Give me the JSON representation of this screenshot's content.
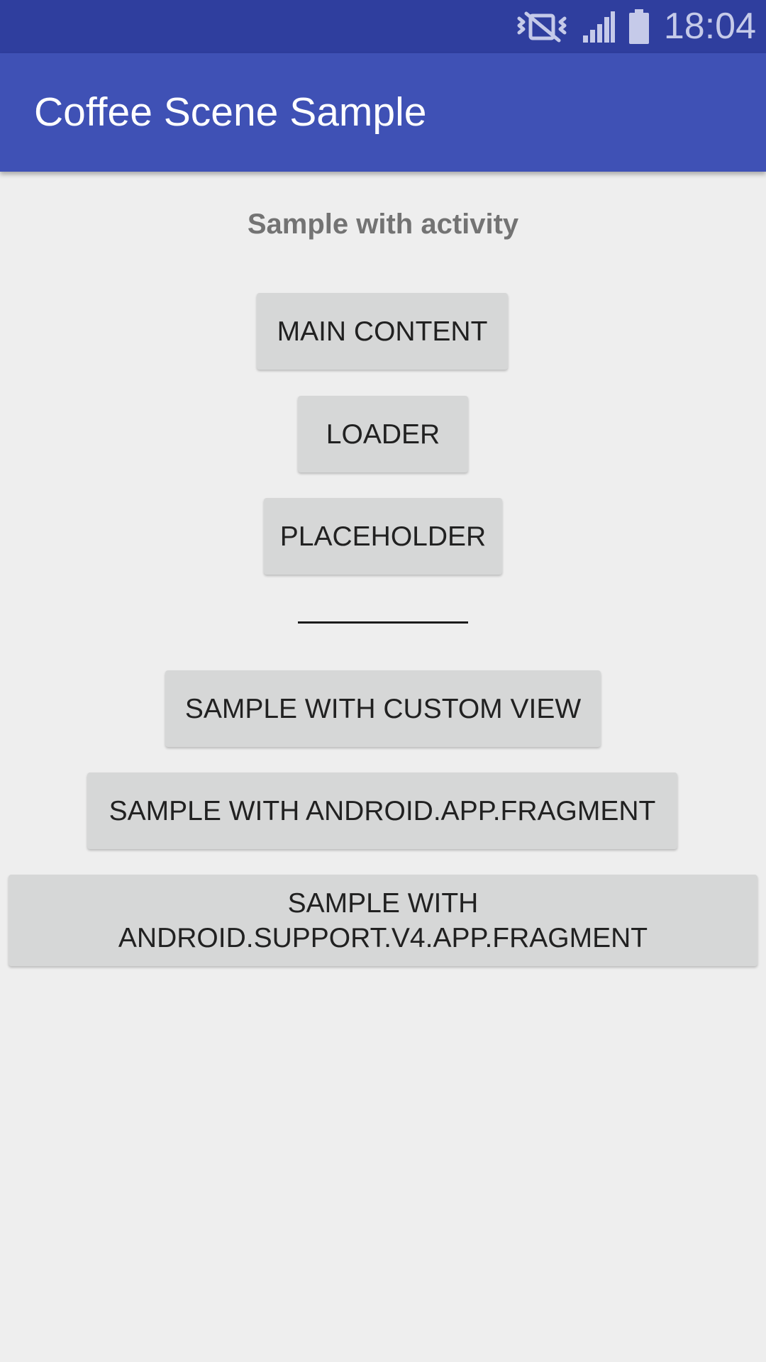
{
  "status_bar": {
    "time": "18:04",
    "icons": [
      "vibrate-mute-icon",
      "cell-signal-icon",
      "battery-icon"
    ]
  },
  "app_bar": {
    "title": "Coffee Scene Sample"
  },
  "main": {
    "section_label": "Sample with activity",
    "buttons": {
      "main_content": "MAIN CONTENT",
      "loader": "LOADER",
      "placeholder": "PLACEHOLDER",
      "custom_view": "SAMPLE WITH CUSTOM VIEW",
      "app_fragment": "SAMPLE WITH ANDROID.APP.FRAGMENT",
      "support_fragment_line1": "SAMPLE WITH",
      "support_fragment_line2": "ANDROID.SUPPORT.V4.APP.FRAGMENT"
    }
  },
  "colors": {
    "status_bar": "#2f3e9e",
    "app_bar": "#3f51b5",
    "background": "#eeeeee",
    "button": "#d6d7d7"
  }
}
